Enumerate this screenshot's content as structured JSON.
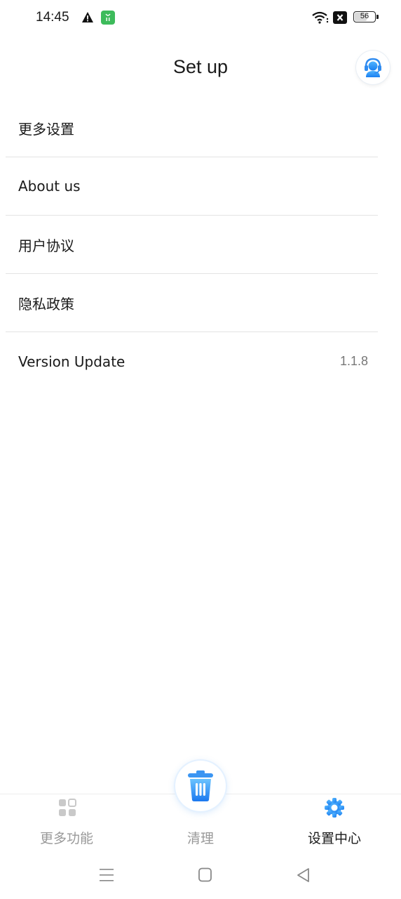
{
  "status_bar": {
    "time": "14:45",
    "battery_level": "56",
    "icons": [
      "warning-icon",
      "app-notification-icon",
      "wifi-icon",
      "sim-off-icon",
      "battery-icon"
    ]
  },
  "header": {
    "title": "Set up",
    "support_icon": "customer-service-icon"
  },
  "menu": {
    "items": [
      {
        "label": "更多设置"
      },
      {
        "label": "About us"
      },
      {
        "label": "用户协议"
      },
      {
        "label": "隐私政策"
      },
      {
        "label": "Version Update",
        "value": "1.1.8"
      }
    ]
  },
  "bottom_nav": {
    "items": [
      {
        "label": "更多功能",
        "icon": "grid-icon",
        "active": false
      },
      {
        "label": "清理",
        "icon": "trash-icon",
        "active": false
      },
      {
        "label": "设置中心",
        "icon": "gear-icon",
        "active": true
      }
    ]
  },
  "system_nav": {
    "icons": [
      "menu-icon",
      "home-icon",
      "back-icon"
    ]
  },
  "colors": {
    "accent": "#2f8bf0",
    "active_text": "#1a1a1a",
    "inactive_text": "#999999",
    "divider": "#e3e3e3"
  }
}
